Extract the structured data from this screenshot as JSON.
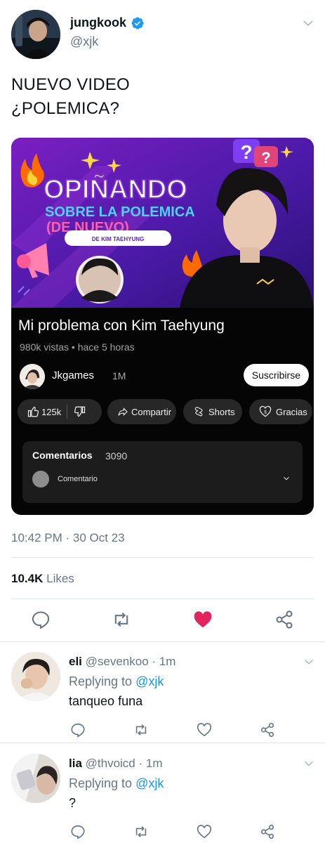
{
  "tweet": {
    "display_name": "jungkook",
    "username": "@xjk",
    "text_line1": "NUEVO VIDEO",
    "text_line2": "¿POLEMICA?",
    "timestamp": "10:42 PM · 30 Oct 23",
    "likes_count": "10.4K",
    "likes_label": "Likes"
  },
  "video_card": {
    "thumbnail_line1": "OPIÑANDO",
    "thumbnail_line2": "SOBRE LA POLEMICA",
    "thumbnail_line3": "(DE NUEVO)",
    "thumbnail_tag": "DE KIM TAEHYUNG",
    "title": "Mi problema con Kim Taehyung",
    "meta": "980k vistas • hace 5 horas",
    "channel_name": "Jkgames",
    "channel_subs": "1M",
    "subscribe_label": "Suscribirse",
    "like_count": "125k",
    "share_label": "Compartir",
    "shorts_label": "Shorts",
    "thanks_label": "Gracias",
    "comments_title": "Comentarios",
    "comments_count": "3090",
    "comment_placeholder": "Comentario"
  },
  "replies": [
    {
      "name": "eli",
      "handle": "@sevenkoo",
      "time": "· 1m",
      "replying_prefix": "Replying to",
      "replying_to": "@xjk",
      "text": "tanqueo funa"
    },
    {
      "name": "lia",
      "handle": "@thvoicd",
      "time": "· 1m",
      "replying_prefix": "Replying to",
      "replying_to": "@xjk",
      "text": "?"
    }
  ],
  "colors": {
    "verified_blue": "#1d9bf0",
    "like_red": "#e0245e",
    "link_blue": "#1b95e0",
    "muted_gray": "#657786"
  },
  "icons": [
    "verified-badge-icon",
    "chevron-down-icon",
    "reply-icon",
    "retweet-icon",
    "heart-filled-icon",
    "heart-icon",
    "share-icon",
    "thumb-up-icon",
    "thumb-down-icon",
    "share-arrow-icon",
    "shorts-icon",
    "thanks-icon"
  ]
}
